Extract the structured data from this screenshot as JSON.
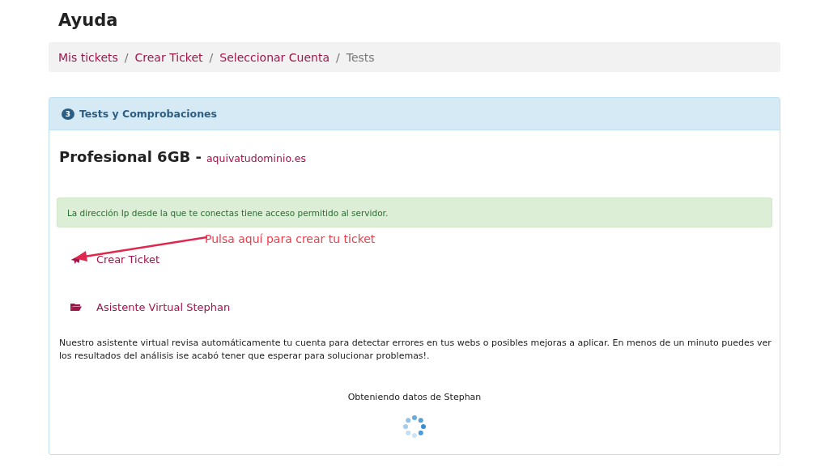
{
  "page_title": "Ayuda",
  "breadcrumb": {
    "separator": "/",
    "items": [
      {
        "label": "Mis tickets",
        "kind": "link"
      },
      {
        "label": "Crear Ticket",
        "kind": "link"
      },
      {
        "label": "Seleccionar Cuenta",
        "kind": "link"
      },
      {
        "label": "Tests",
        "kind": "current"
      }
    ]
  },
  "panel": {
    "step": "3",
    "title": "Tests y Comprobaciones",
    "product": "Profesional 6GB -",
    "domain": "aquivatudominio.es",
    "alert": "La dirección Ip desde la que te conectas tiene acceso permitido al servidor.",
    "actions": [
      {
        "label": "Crear Ticket",
        "kind": "ticket"
      },
      {
        "label": "Asistente Virtual Stephan",
        "kind": "assistant"
      }
    ],
    "description": "Nuestro asistente virtual revisa automáticamente tu cuenta para detectar errores en tus webs o posibles mejoras a aplicar. En menos de un minuto puedes ver los resultados del análisis ise acabó tener que esperar para solucionar problemas!.",
    "loading": "Obteniendo datos de Stephan"
  },
  "annotation": {
    "text": "Pulsa aquí para crear tu ticket"
  }
}
